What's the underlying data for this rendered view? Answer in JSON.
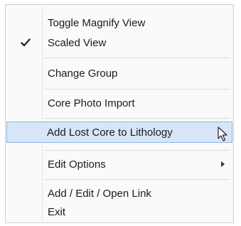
{
  "menu": {
    "items": [
      {
        "label": "Toggle Magnify View"
      },
      {
        "label": "Scaled View",
        "checked": true
      },
      {
        "label": "Change Group"
      },
      {
        "label": "Core Photo Import"
      },
      {
        "label": "Add Lost Core to Lithology",
        "highlighted": true
      },
      {
        "label": "Edit Options",
        "has_submenu": true
      },
      {
        "label": "Add / Edit / Open Link"
      },
      {
        "label": "Exit"
      }
    ]
  },
  "colors": {
    "highlight_fill": "#d7e5f7",
    "highlight_border": "#8fb3e2",
    "menu_background": "#fafafa",
    "text": "#1b1b1b"
  },
  "icons": {
    "check": "check-icon",
    "submenu": "submenu-arrow-icon",
    "pointer": "mouse-pointer-icon"
  }
}
